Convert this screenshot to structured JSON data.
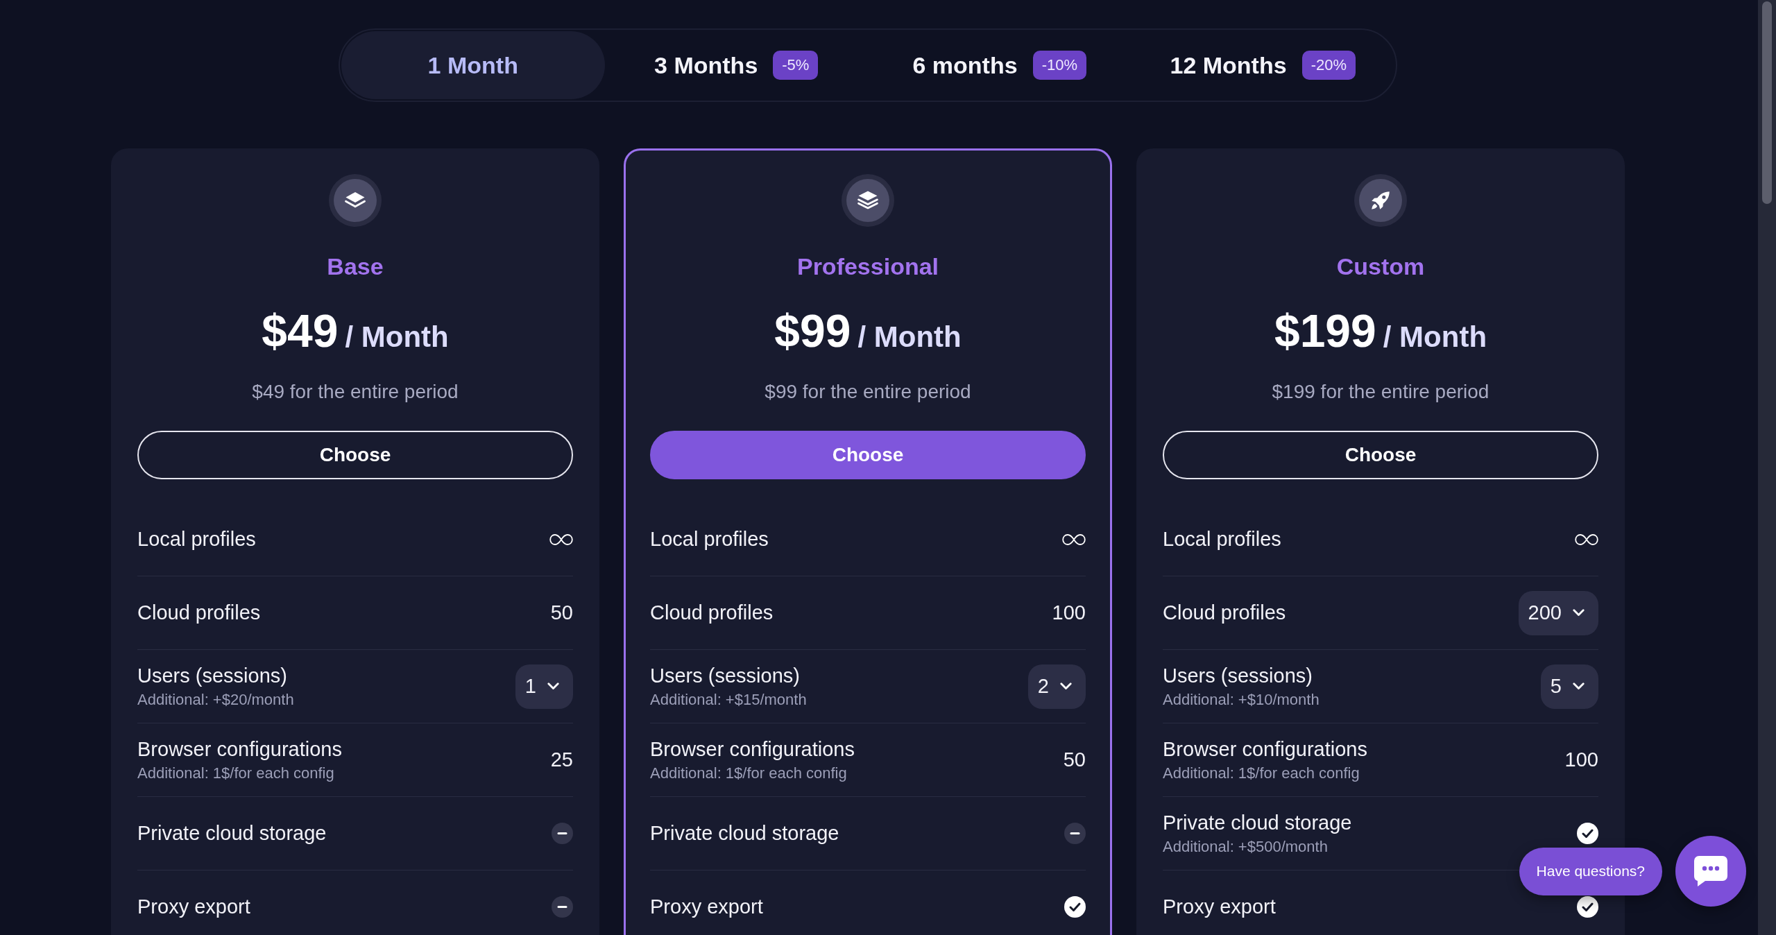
{
  "billing_periods": [
    {
      "label": "1 Month",
      "selected": true
    },
    {
      "label": "3 Months",
      "discount": "-5%",
      "selected": false
    },
    {
      "label": "6 months",
      "discount": "-10%",
      "selected": false
    },
    {
      "label": "12 Months",
      "discount": "-20%",
      "selected": false
    }
  ],
  "plans": [
    {
      "name": "Base",
      "price": "$49",
      "period": "/ Month",
      "total": "$49 for the entire period",
      "button": "Choose",
      "highlighted": false,
      "features": [
        {
          "label": "Local profiles",
          "kind": "unlimited"
        },
        {
          "label": "Cloud profiles",
          "kind": "number",
          "value": "50"
        },
        {
          "label": "Users (sessions)",
          "note": "Additional: +$20/month",
          "kind": "select",
          "value": "1"
        },
        {
          "label": "Browser configurations",
          "note": "Additional: 1$/for each config",
          "kind": "number",
          "value": "25"
        },
        {
          "label": "Private cloud storage",
          "kind": "included",
          "included": false
        },
        {
          "label": "Proxy export",
          "kind": "included",
          "included": false
        }
      ]
    },
    {
      "name": "Professional",
      "price": "$99",
      "period": "/ Month",
      "total": "$99 for the entire period",
      "button": "Choose",
      "highlighted": true,
      "features": [
        {
          "label": "Local profiles",
          "kind": "unlimited"
        },
        {
          "label": "Cloud profiles",
          "kind": "number",
          "value": "100"
        },
        {
          "label": "Users (sessions)",
          "note": "Additional: +$15/month",
          "kind": "select",
          "value": "2"
        },
        {
          "label": "Browser configurations",
          "note": "Additional: 1$/for each config",
          "kind": "number",
          "value": "50"
        },
        {
          "label": "Private cloud storage",
          "kind": "included",
          "included": false
        },
        {
          "label": "Proxy export",
          "kind": "included",
          "included": true
        }
      ]
    },
    {
      "name": "Custom",
      "price": "$199",
      "period": "/ Month",
      "total": "$199 for the entire period",
      "button": "Choose",
      "highlighted": false,
      "features": [
        {
          "label": "Local profiles",
          "kind": "unlimited"
        },
        {
          "label": "Cloud profiles",
          "kind": "select",
          "value": "200"
        },
        {
          "label": "Users (sessions)",
          "note": "Additional: +$10/month",
          "kind": "select",
          "value": "5"
        },
        {
          "label": "Browser configurations",
          "note": "Additional: 1$/for each config",
          "kind": "number",
          "value": "100"
        },
        {
          "label": "Private cloud storage",
          "note": "Additional: +$500/month",
          "kind": "included",
          "included": true
        },
        {
          "label": "Proxy export",
          "kind": "included",
          "included": true
        }
      ]
    }
  ],
  "chat": {
    "prompt": "Have questions?"
  }
}
